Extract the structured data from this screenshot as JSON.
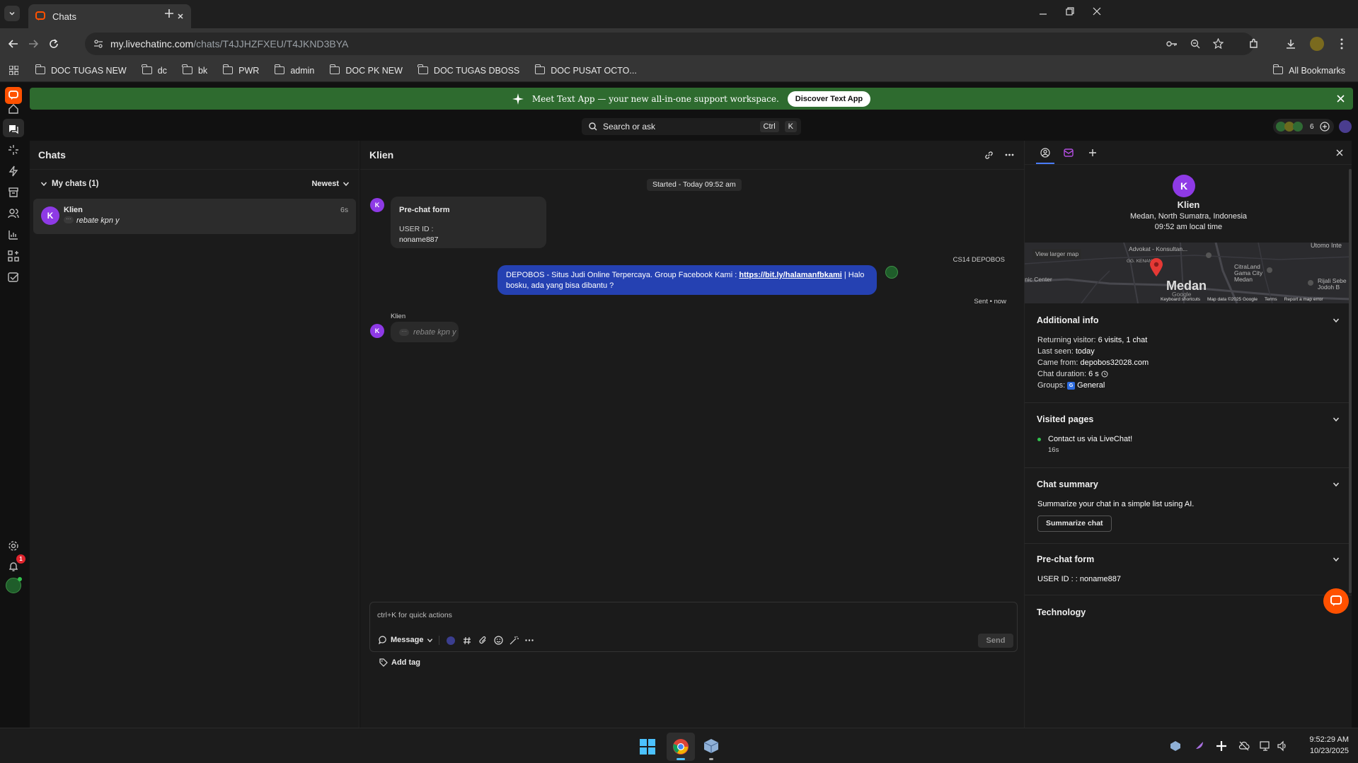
{
  "browser": {
    "tab_title": "Chats",
    "url_host": "my.livechatinc.com",
    "url_path": "/chats/T4JJHZFXEU/T4JKND3BYA",
    "bookmarks": [
      "DOC TUGAS NEW",
      "dc",
      "bk",
      "PWR",
      "admin",
      "DOC PK NEW",
      "DOC TUGAS DBOSS",
      "DOC PUSAT OCTO..."
    ],
    "all_bookmarks": "All Bookmarks"
  },
  "banner": {
    "text": "Meet Text App — your new all-in-one support workspace.",
    "button": "Discover Text App"
  },
  "topbar": {
    "search_placeholder": "Search or ask",
    "shortcut_ctrl": "Ctrl",
    "shortcut_k": "K",
    "agents_count": "6"
  },
  "rail": {
    "notification_badge": "1"
  },
  "chat_list": {
    "title": "Chats",
    "group_label": "My chats (1)",
    "sort_label": "Newest",
    "items": [
      {
        "avatar": "K",
        "name": "Klien",
        "time": "6s",
        "preview": "rebate kpn y"
      }
    ]
  },
  "conversation": {
    "title": "Klien",
    "started": "Started - Today 09:52 am",
    "form": {
      "avatar": "K",
      "title": "Pre-chat form",
      "field_label": "USER ID :",
      "field_value": "noname887"
    },
    "agent_message": {
      "sender": "CS14 DEPOBOS",
      "text_before": "DEPOBOS - Situs Judi Online Terpercaya. Group Facebook Kami : ",
      "link": "https://bit.ly/halamanfbkami",
      "text_after": " | Halo bosku, ada yang bisa dibantu ?",
      "status": "Sent • now"
    },
    "typing": {
      "avatar": "K",
      "sender": "Klien",
      "text": "rebate kpn y"
    },
    "composer": {
      "placeholder": "ctrl+K for quick actions",
      "mode": "Message",
      "send": "Send",
      "add_tag": "Add tag"
    }
  },
  "details": {
    "avatar": "K",
    "name": "Klien",
    "location": "Medan, North Sumatra, Indonesia",
    "local_time": "09:52 am local time",
    "map": {
      "view_larger": "View larger map",
      "city": "Medan",
      "labels": [
        "Advokat - Konsultan...",
        "CitraLand Gama City Medan",
        "Utomo Inte",
        "nic Center",
        "Rijali Sebe Jodoh B",
        "GG. KENANGA",
        "Google"
      ],
      "footer": [
        "Keyboard shortcuts",
        "Map data ©2025 Google",
        "Terms",
        "Report a map error"
      ]
    },
    "additional_info": {
      "title": "Additional info",
      "rows": [
        {
          "label": "Returning visitor: ",
          "value": "6 visits, 1 chat"
        },
        {
          "label": "Last seen: ",
          "value": "today"
        },
        {
          "label": "Came from: ",
          "value": "depobos32028.com"
        },
        {
          "label": "Chat duration: ",
          "value": "6 s"
        },
        {
          "label": "Groups: ",
          "value": "General",
          "badge": "G"
        }
      ]
    },
    "visited_pages": {
      "title": "Visited pages",
      "page": "Contact us via LiveChat!",
      "duration": "16s"
    },
    "chat_summary": {
      "title": "Chat summary",
      "text": "Summarize your chat in a simple list using AI.",
      "button": "Summarize chat"
    },
    "prechat_form": {
      "title": "Pre-chat form",
      "field": "USER ID : : noname887"
    },
    "technology": {
      "title": "Technology"
    }
  },
  "taskbar": {
    "time": "9:52:29 AM",
    "date": "10/23/2025"
  },
  "colors": {
    "accent_purple": "#8e3ae6",
    "agent_bubble": "#2541b2",
    "banner_green": "#2e6b2f",
    "brand_orange": "#ff5100"
  }
}
